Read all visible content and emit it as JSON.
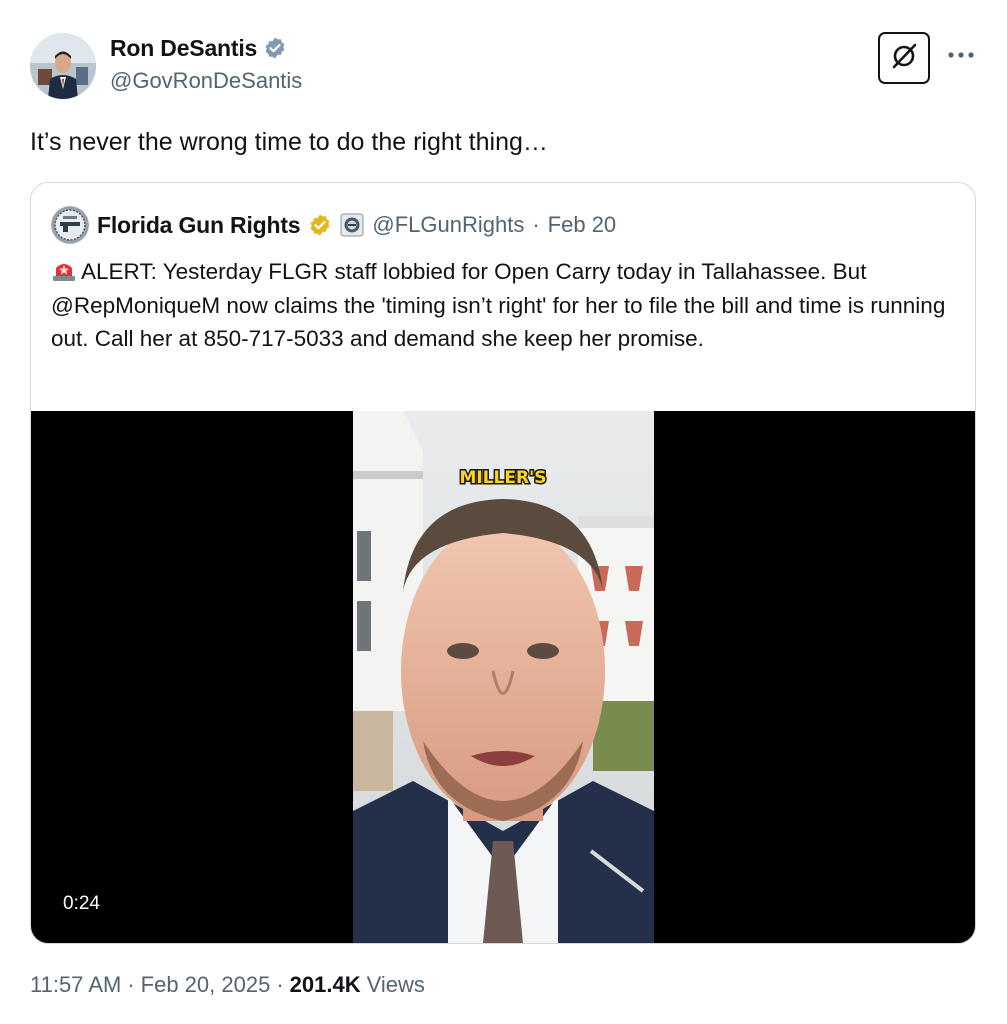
{
  "tweet": {
    "author_name": "Ron DeSantis",
    "author_handle": "@GovRonDeSantis",
    "text": "It’s never the wrong time to do the right thing…",
    "time": "11:57 AM",
    "separator": "·",
    "date": "Feb 20, 2025",
    "views_count": "201.4K",
    "views_label": "Views"
  },
  "quote": {
    "author_name": "Florida Gun Rights",
    "author_handle": "@FLGunRights",
    "separator": "·",
    "date": "Feb 20",
    "text": "ALERT: Yesterday FLGR staff lobbied for Open Carry today in Tallahassee. But @RepMoniqueM  now claims the 'timing isn’t right' for her to file the bill and time is running out. Call her at 850-717-5033 and demand she keep her promise.",
    "video": {
      "duration": "0:24",
      "caption": "MILLER'S"
    }
  },
  "icons": {
    "verified_gray": "verified-badge-gray-icon",
    "verified_gold": "verified-badge-gold-icon",
    "org_affiliate": "org-affiliate-icon",
    "grok": "grok-icon",
    "more": "more-options-icon",
    "siren": "rotating-light-emoji"
  },
  "colors": {
    "text_primary": "#0f1419",
    "text_secondary": "#536471",
    "border": "#cfd9de",
    "gold_badge": "#e2b719",
    "gray_badge": "#829aab"
  }
}
